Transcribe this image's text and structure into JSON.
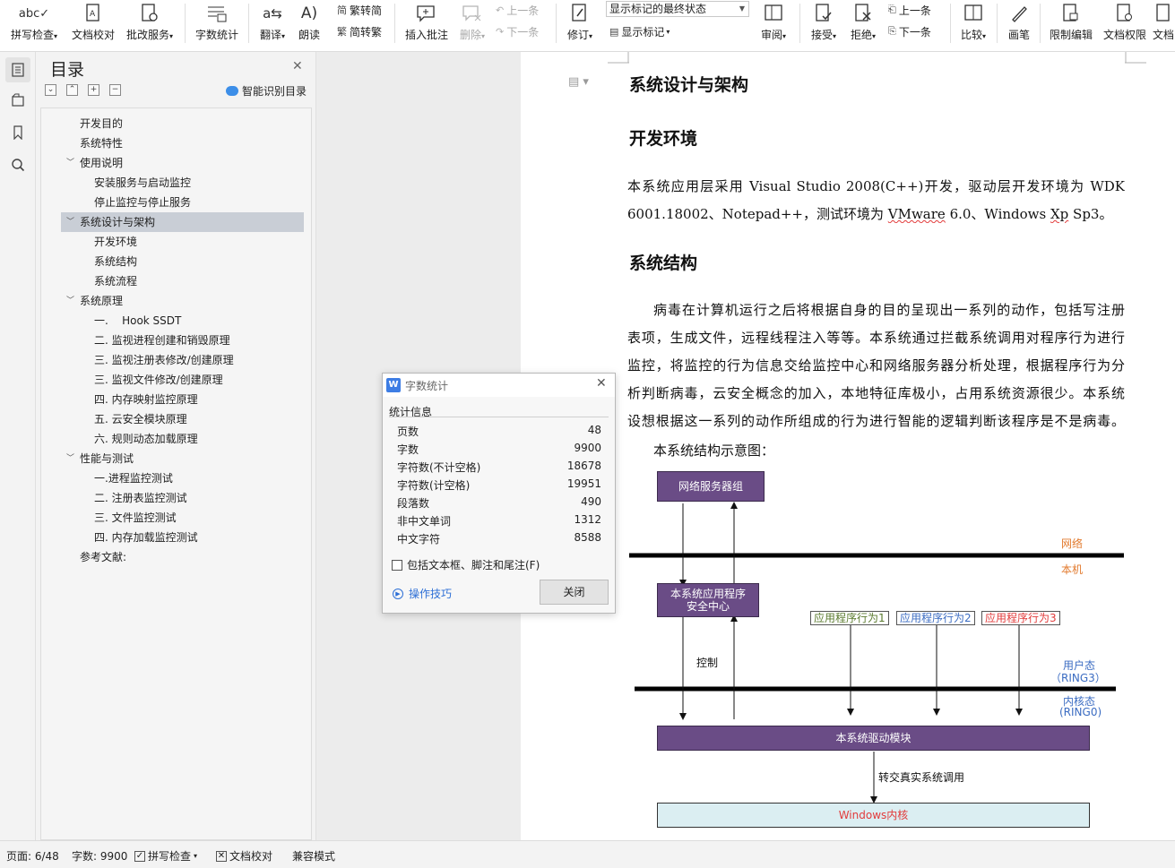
{
  "ribbon": {
    "spell_check": "拼写检查",
    "doc_proof": "文档校对",
    "batch_service": "批改服务",
    "word_count": "字数统计",
    "translate": "翻译",
    "read_aloud": "朗读",
    "to_traditional": "繁转简",
    "to_simplified": "简转繁",
    "insert_comment": "插入批注",
    "delete": "删除",
    "prev": "上一条",
    "next": "下一条",
    "revise": "修订",
    "markup_state": "显示标记的最终状态",
    "show_markup": "显示标记",
    "review": "审阅",
    "accept": "接受",
    "reject": "拒绝",
    "prev2": "上一条",
    "next2": "下一条",
    "compare": "比较",
    "pen": "画笔",
    "restrict_edit": "限制编辑",
    "doc_permission": "文档权限",
    "doc_more": "文档"
  },
  "toc": {
    "title": "目录",
    "smart_label": "智能识别目录",
    "items": [
      {
        "label": "开发目的"
      },
      {
        "label": "系统特性"
      },
      {
        "label": "使用说明"
      },
      {
        "label": "安装服务与启动监控"
      },
      {
        "label": "停止监控与停止服务"
      },
      {
        "label": "系统设计与架构"
      },
      {
        "label": "开发环境"
      },
      {
        "label": "系统结构"
      },
      {
        "label": "系统流程"
      },
      {
        "label": "系统原理"
      },
      {
        "label": "一.    Hook SSDT"
      },
      {
        "label": "二. 监视进程创建和销毁原理"
      },
      {
        "label": "三. 监视注册表修改/创建原理"
      },
      {
        "label": "三. 监视文件修改/创建原理"
      },
      {
        "label": "四. 内存映射监控原理"
      },
      {
        "label": "五. 云安全模块原理"
      },
      {
        "label": "六. 规则动态加载原理"
      },
      {
        "label": "性能与测试"
      },
      {
        "label": "一.进程监控测试"
      },
      {
        "label": "二. 注册表监控测试"
      },
      {
        "label": "三. 文件监控测试"
      },
      {
        "label": "四. 内存加载监控测试"
      },
      {
        "label": "参考文献:"
      }
    ]
  },
  "document": {
    "h1": "系统设计与架构",
    "h2a": "开发环境",
    "p1": {
      "line1": "本系统应用层采用 Visual Studio 2008(C++)开发，驱动层开发环境为 WDK",
      "line2_pre": "6001.18002、Notepad++，测试环境为 ",
      "line2_vm": "VMware",
      "line2_mid": " 6.0、Windows ",
      "line2_xp": "Xp",
      "line2_post": " Sp3。"
    },
    "h2b": "系统结构",
    "p2": [
      "病毒在计算机运行之后将根据自身的目的呈现出一系列的动作，包括写注册",
      "表项，生成文件，远程线程注入等等。本系统通过拦截系统调用对程序行为进行",
      "监控，将监控的行为信息交给监控中心和网络服务器分析处理，根据程序行为分",
      "析判断病毒，云安全概念的加入，本地特征库极小，占用系统资源很少。本系统",
      "设想根据这一系列的动作所组成的行为进行智能的逻辑判断该程序是不是病毒。"
    ],
    "p3": "本系统结构示意图："
  },
  "diagram": {
    "server_group": "网络服务器组",
    "network": "网络",
    "local": "本机",
    "security_center_l1": "本系统应用程序",
    "security_center_l2": "安全中心",
    "app1": "应用程序行为1",
    "app2": "应用程序行为2",
    "app3": "应用程序行为3",
    "control": "控制",
    "user_mode_l1": "用户态",
    "user_mode_l2": "（RING3）",
    "kernel_mode_l1": "内核态",
    "kernel_mode_l2": "(RING0)",
    "driver_module": "本系统驱动模块",
    "forward": "转交真实系统调用",
    "kernel": "Windows内核",
    "colors": {
      "purple": "#6a4c86",
      "orange": "#e27a2e",
      "blue": "#3b6cc2",
      "red": "#e23b3b",
      "green": "#5a7a2e",
      "kernel_fill": "#dbeef2"
    }
  },
  "dialog": {
    "title": "字数统计",
    "section": "统计信息",
    "stats": [
      {
        "k": "页数",
        "v": "48"
      },
      {
        "k": "字数",
        "v": "9900"
      },
      {
        "k": "字符数(不计空格)",
        "v": "18678"
      },
      {
        "k": "字符数(计空格)",
        "v": "19951"
      },
      {
        "k": "段落数",
        "v": "490"
      },
      {
        "k": "非中文单词",
        "v": "1312"
      },
      {
        "k": "中文字符",
        "v": "8588"
      }
    ],
    "include_label": "包括文本框、脚注和尾注(F)",
    "tips": "操作技巧",
    "close": "关闭"
  },
  "status": {
    "page": "页面: 6/48",
    "words": "字数: 9900",
    "spell": "拼写检查",
    "proof": "文档校对",
    "compat": "兼容模式"
  }
}
